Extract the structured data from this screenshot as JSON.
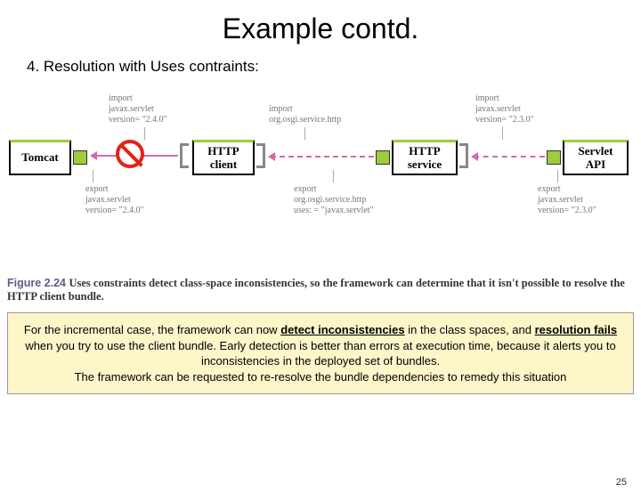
{
  "title": "Example contd.",
  "subtitle": "4. Resolution with Uses contraints:",
  "bundles": {
    "tomcat": "Tomcat",
    "http_client": "HTTP client",
    "http_service": "HTTP service",
    "servlet_api": "Servlet API"
  },
  "labels": {
    "imp1": "import\njavax.servlet\nversion= \"2.4.0\"",
    "exp1": "export\njavax.servlet\nversion= \"2.4.0\"",
    "imp2": "import\norg.osgi.service.http",
    "exp2": "export\norg.osgi.service.http\nuses: = \"javax.servlet\"",
    "imp3": "import\njavax.servlet\nversion= \"2.3.0\"",
    "exp3": "export\njavax.servlet\nversion= \"2.3.0\""
  },
  "caption": {
    "fignum": "Figure 2.24",
    "text": "Uses constraints detect class-space inconsistencies, so the framework can determine that it isn't possible to resolve the HTTP client bundle."
  },
  "note": {
    "p1a": "For the incremental case, the framework can now ",
    "p1b": "detect inconsistencies",
    "p1c": " in the class spaces, and ",
    "p1d": "resolution fails",
    "p1e": " when you try to use the client bundle. Early detection is better than errors at execution time, because it alerts you to inconsistencies in the deployed set of bundles.",
    "p2": "The framework can be requested to re-resolve the bundle dependencies to remedy this situation"
  },
  "pagenum": "25"
}
